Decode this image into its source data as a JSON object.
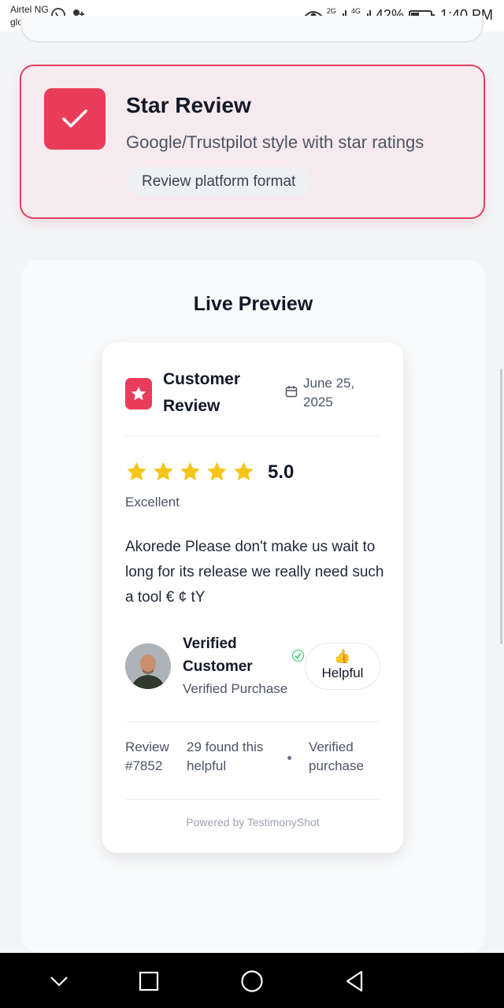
{
  "status_bar": {
    "carrier_line1": "Airtel NG",
    "carrier_line2": "glo ng",
    "network_1": "2G",
    "network_2": "4G",
    "battery": "42%",
    "battery_level": 0.42,
    "time": "1:40 PM",
    "icons": [
      "whatsapp-icon",
      "contact-icon",
      "eye-icon",
      "signal-icon",
      "battery-icon"
    ]
  },
  "option_card": {
    "title": "Star Review",
    "description": "Google/Trustpilot style with star ratings",
    "tag": "Review platform format",
    "selected": true,
    "accent": "#e93c5b"
  },
  "preview": {
    "title": "Live Preview",
    "card": {
      "title": "Customer Review",
      "date": "June 25, 2025",
      "rating": "5.0",
      "stars": 5,
      "rating_word": "Excellent",
      "text": "Akorede Please don't make us wait to long for its release we really need such a tool € ¢ tY",
      "customer_name": "Verified Customer",
      "customer_sub": "Verified Purchase",
      "helpful_label": "Helpful",
      "review_id": "Review #7852",
      "found_helpful": "29 found this helpful",
      "verified_note": "Verified purchase",
      "powered_by": "Powered by TestimonyShot",
      "star_color": "#f5c518"
    }
  },
  "nav": {
    "icons": [
      "chevron-down-icon",
      "recents-icon",
      "home-icon",
      "back-icon"
    ]
  }
}
